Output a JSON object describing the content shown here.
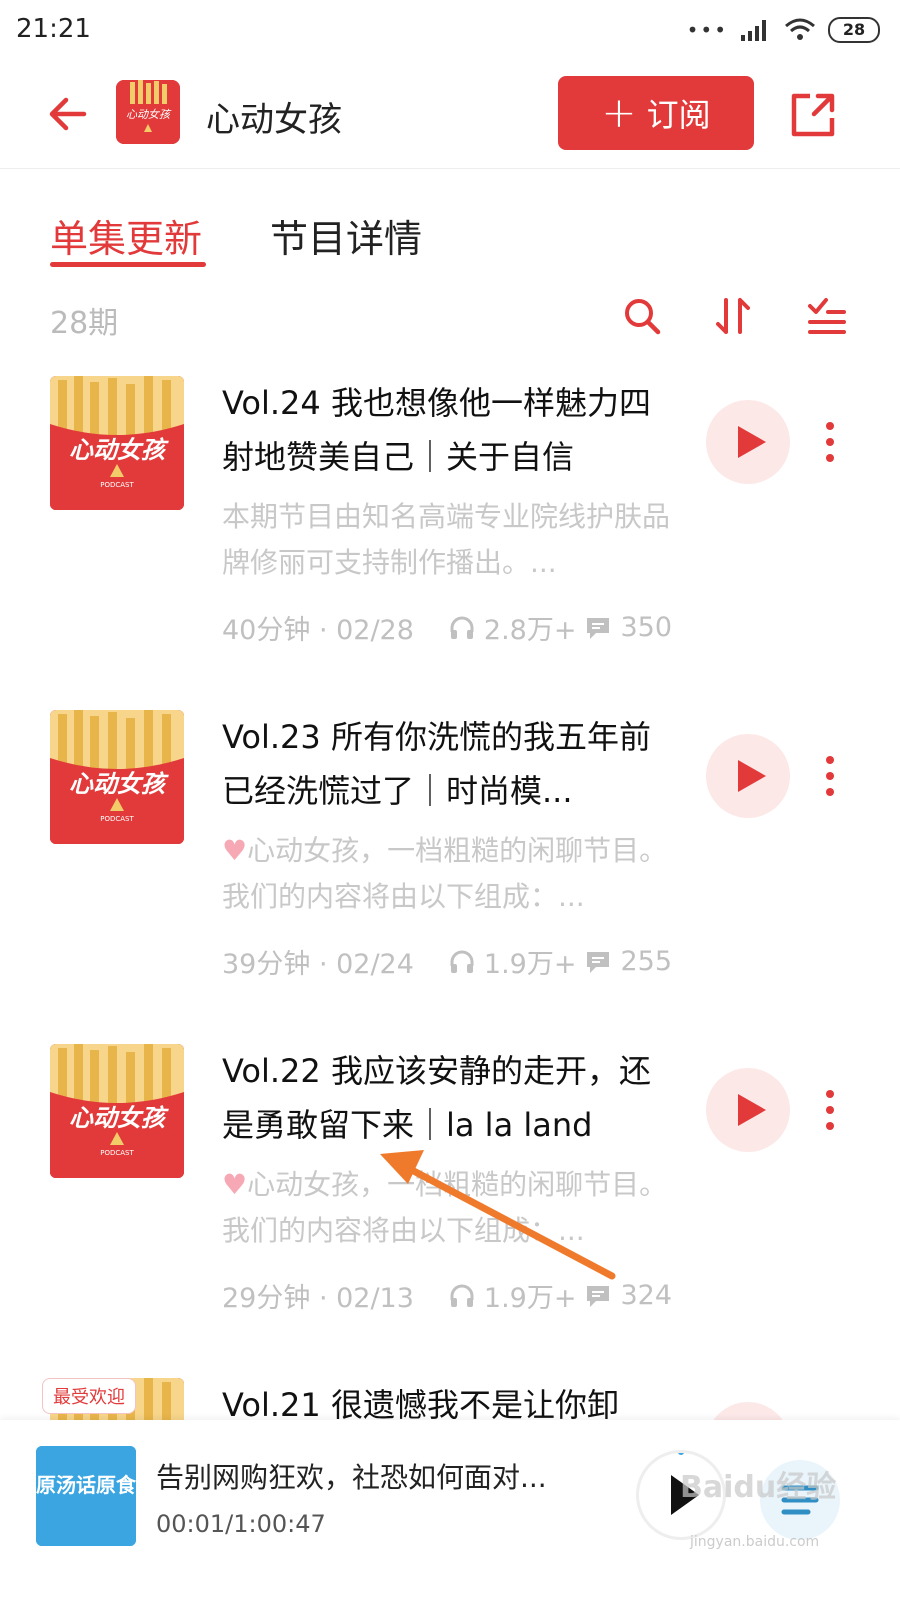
{
  "status": {
    "time": "21:21",
    "battery": "28"
  },
  "header": {
    "title": "心动女孩",
    "subscribe_label": "订阅",
    "plus": "+"
  },
  "tabs": [
    {
      "label": "单集更新"
    },
    {
      "label": "节目详情"
    }
  ],
  "list": {
    "count": "28期"
  },
  "cover_text": "心动女孩",
  "cover_sub": "PODCAST",
  "episodes": [
    {
      "title": "Vol.24 我也想像他一样魅力四射地赞美自己｜关于自信",
      "desc": "本期节目由知名高端专业院线护肤品牌修丽可支持制作播出。...",
      "duration": "40分钟 · 02/28",
      "plays": "2.8万+",
      "comments": "350"
    },
    {
      "title": "Vol.23 所有你洗慌的我五年前已经洗慌过了｜时尚模...",
      "desc": "心动女孩，一档粗糙的闲聊节目。我们的内容将由以下组成：...",
      "duration": "39分钟 · 02/24",
      "plays": "1.9万+",
      "comments": "255"
    },
    {
      "title": "Vol.22 我应该安静的走开，还是勇敢留下来｜la la land",
      "desc": "心动女孩，一档粗糙的闲聊节目。我们的内容将由以下组成：...",
      "duration": "29分钟 · 02/13",
      "plays": "1.9万+",
      "comments": "324"
    },
    {
      "title": "Vol.21 很遗憾我不是让你卸",
      "badge": "最受欢迎"
    }
  ],
  "player": {
    "title": "告别网购狂欢，社恐如何面对...",
    "time": "00:01/1:00:47",
    "cover_text": "原汤话原食"
  },
  "watermark": {
    "main": "Baidu经验",
    "sub": "jingyan.baidu.com"
  },
  "colors": {
    "accent": "#e23a3a",
    "muted": "#c0c0c0"
  }
}
